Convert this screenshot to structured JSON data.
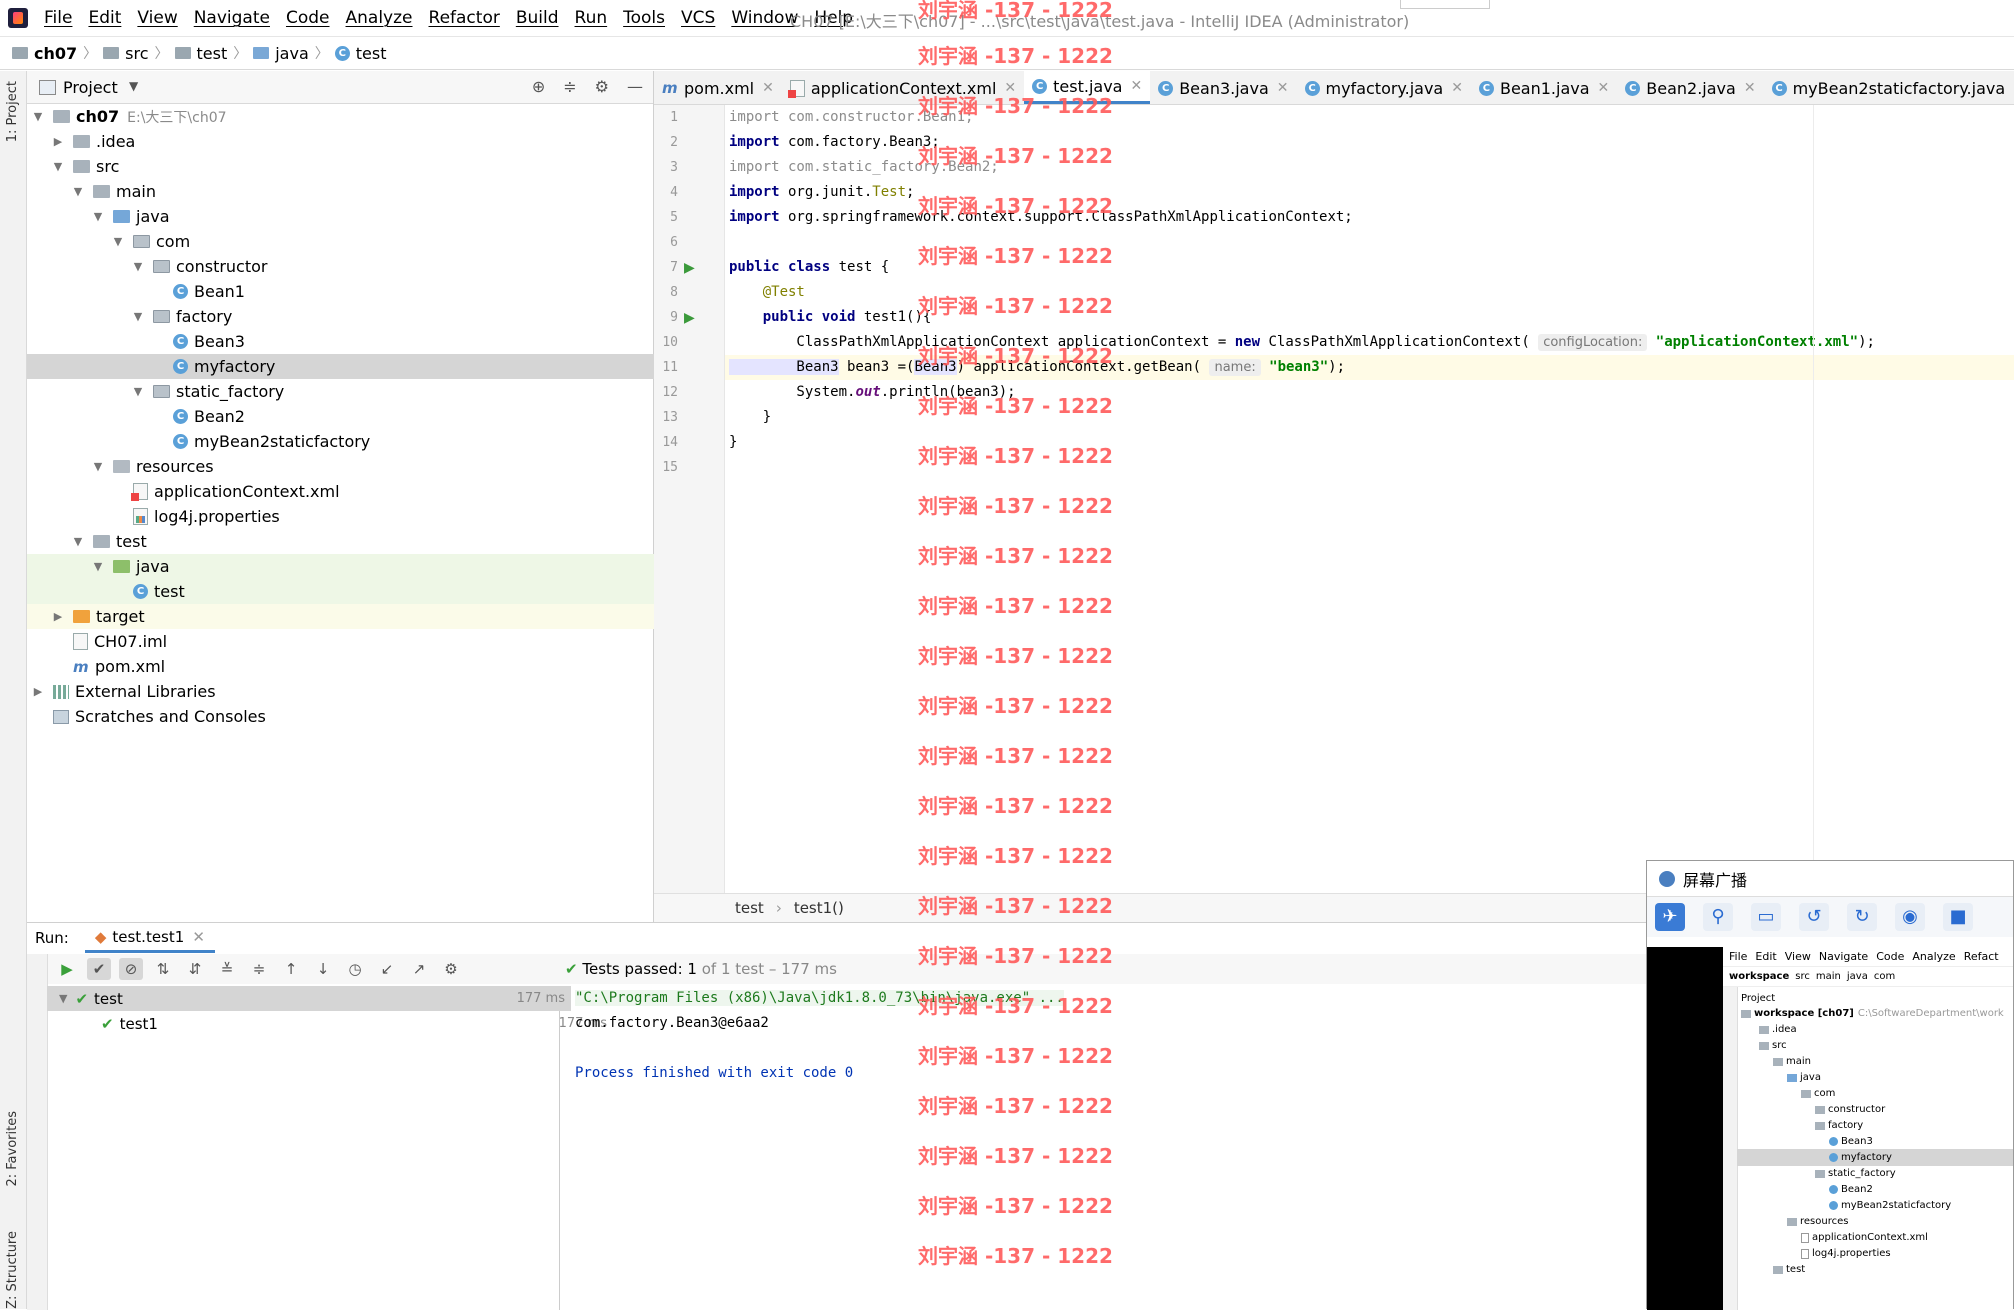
{
  "window": {
    "title": "CH07 [E:\\大三下\\ch07] - ...\\src\\test\\java\\test.java - IntelliJ IDEA (Administrator)",
    "menu": [
      "File",
      "Edit",
      "View",
      "Navigate",
      "Code",
      "Analyze",
      "Refactor",
      "Build",
      "Run",
      "Tools",
      "VCS",
      "Window",
      "Help"
    ]
  },
  "breadcrumbs": [
    "ch07",
    "src",
    "test",
    "java",
    "test"
  ],
  "side_labels": {
    "project": "1: Project",
    "favorites": "2: Favorites",
    "structure": "Z: Structure"
  },
  "project_panel": {
    "title": "Project",
    "tree": [
      {
        "label": "ch07",
        "path": "E:\\大三下\\ch07",
        "bold": true
      },
      {
        "label": ".idea"
      },
      {
        "label": "src"
      },
      {
        "label": "main"
      },
      {
        "label": "java"
      },
      {
        "label": "com"
      },
      {
        "label": "constructor"
      },
      {
        "label": "Bean1"
      },
      {
        "label": "factory"
      },
      {
        "label": "Bean3"
      },
      {
        "label": "myfactory"
      },
      {
        "label": "static_factory"
      },
      {
        "label": "Bean2"
      },
      {
        "label": "myBean2staticfactory"
      },
      {
        "label": "resources"
      },
      {
        "label": "applicationContext.xml"
      },
      {
        "label": "log4j.properties"
      },
      {
        "label": "test"
      },
      {
        "label": "java"
      },
      {
        "label": "test"
      },
      {
        "label": "target"
      },
      {
        "label": "CH07.iml"
      },
      {
        "label": "pom.xml"
      },
      {
        "label": "External Libraries"
      },
      {
        "label": "Scratches and Consoles"
      }
    ]
  },
  "editor": {
    "tabs": [
      {
        "label": "pom.xml"
      },
      {
        "label": "applicationContext.xml"
      },
      {
        "label": "test.java"
      },
      {
        "label": "Bean3.java"
      },
      {
        "label": "myfactory.java"
      },
      {
        "label": "Bean1.java"
      },
      {
        "label": "Bean2.java"
      },
      {
        "label": "myBean2staticfactory.java"
      }
    ],
    "active_tab": "test.java",
    "line_numbers": [
      "1",
      "2",
      "3",
      "4",
      "5",
      "6",
      "7",
      "8",
      "9",
      "10",
      "11",
      "12",
      "13",
      "14",
      "15"
    ],
    "code": {
      "l1a": "import",
      "l1b": " com.constructor.Bean1;",
      "l2a": "import",
      "l2b": " com.factory.Bean3;",
      "l3a": "import",
      "l3b": " com.static_factory.Bean2;",
      "l4a": "import",
      "l4b": " org.junit.",
      "l4c": "Test",
      "l4d": ";",
      "l5a": "import",
      "l5b": " org.springframework.context.support.ClassPathXmlApplicationContext;",
      "l7a": "public class",
      "l7b": " test {",
      "l8": "    @Test",
      "l9a": "    public void",
      "l9b": " test1(){",
      "l10a": "        ClassPathXmlApplicationContext applicationContext = ",
      "l10b": "new",
      "l10c": " ClassPathXmlApplicationContext( ",
      "l10hint": "configLocation:",
      "l10d": " \"applicationContext.xml\"",
      "l10e": ");",
      "l11a": "        Bean3",
      "l11b": " bean3 =(",
      "l11c": "Bean3",
      "l11d": ") applicationContext.getBean( ",
      "l11hint": "name:",
      "l11e": " \"bean3\"",
      "l11f": ");",
      "l12a": "        System.",
      "l12b": "out",
      "l12c": ".println(bean3);",
      "l13": "    }",
      "l14": "}"
    },
    "breadcrumb": [
      "test",
      "test1()"
    ]
  },
  "run_panel": {
    "label": "Run:",
    "tab": "test.test1",
    "status_passed": "Tests passed:",
    "status_count": "1",
    "status_rest": "of 1 test – 177 ms",
    "tree": [
      {
        "label": "test",
        "ms": "177 ms"
      },
      {
        "label": "test1",
        "ms": "177 ms"
      }
    ],
    "console": [
      "\"C:\\Program Files (x86)\\Java\\jdk1.8.0_73\\bin\\java.exe\" ...",
      "com.factory.Bean3@e6aa2",
      "",
      "Process finished with exit code 0"
    ]
  },
  "watermark": "刘宇涵 -137 - 1222",
  "broadcast_window": {
    "title": "屏幕广播",
    "mini_menu": [
      "File",
      "Edit",
      "View",
      "Navigate",
      "Code",
      "Analyze",
      "Refact"
    ],
    "mini_crumbs": [
      "workspace",
      "src",
      "main",
      "java",
      "com"
    ],
    "mini_project": "Project",
    "mini_tree": [
      {
        "label": "workspace [ch07]",
        "path": "C:\\SoftwareDepartment\\work"
      },
      {
        "label": ".idea"
      },
      {
        "label": "src"
      },
      {
        "label": "main"
      },
      {
        "label": "java"
      },
      {
        "label": "com"
      },
      {
        "label": "constructor"
      },
      {
        "label": "factory"
      },
      {
        "label": "Bean3"
      },
      {
        "label": "myfactory"
      },
      {
        "label": "static_factory"
      },
      {
        "label": "Bean2"
      },
      {
        "label": "myBean2staticfactory"
      },
      {
        "label": "resources"
      },
      {
        "label": "applicationContext.xml"
      },
      {
        "label": "log4j.properties"
      },
      {
        "label": "test"
      }
    ]
  },
  "colors": {
    "accent": "#4083c9",
    "pass": "#3aa03a",
    "watermark": "#ff5a5a"
  }
}
